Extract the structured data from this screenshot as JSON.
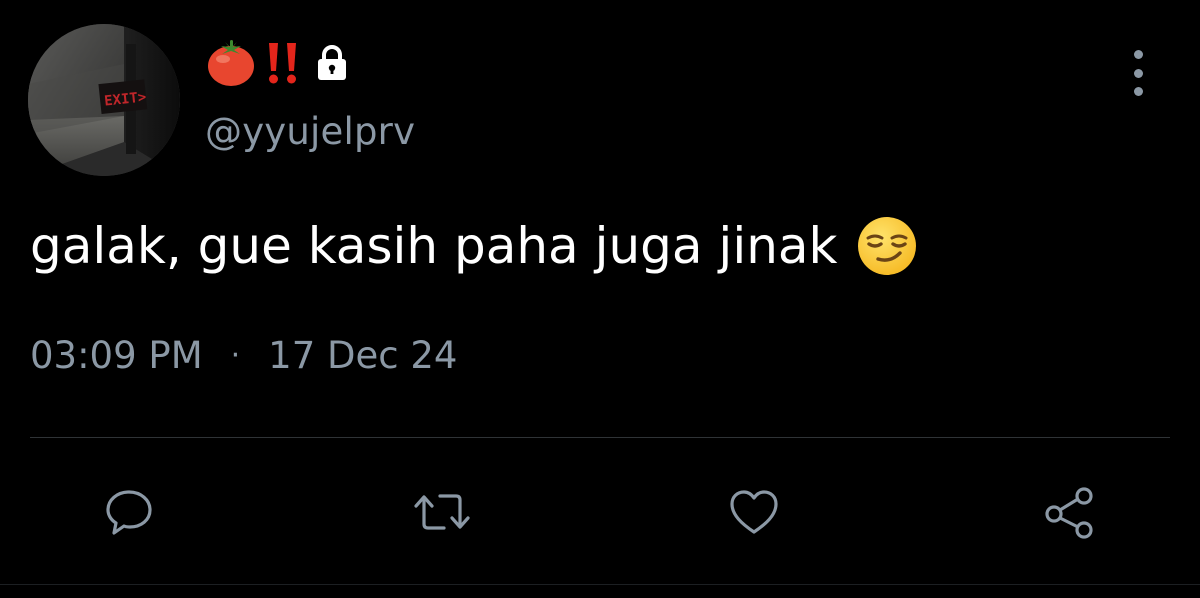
{
  "tweet": {
    "display_name_icons": [
      "tomato-emoji",
      "double-exclamation-emoji",
      "lock-icon"
    ],
    "handle": "@yyujelprv",
    "text": "galak, gue kasih paha juga jinak",
    "text_emoji": "smirking-face-emoji",
    "time": "03:09 PM",
    "separator": "·",
    "date": "17 Dec 24",
    "avatar_sign_text": "EXIT>"
  },
  "actions": [
    {
      "name": "reply",
      "icon": "comment-icon"
    },
    {
      "name": "retweet",
      "icon": "retweet-icon"
    },
    {
      "name": "like",
      "icon": "heart-icon"
    },
    {
      "name": "share",
      "icon": "share-icon"
    }
  ],
  "colors": {
    "background": "#000000",
    "text_primary": "#ffffff",
    "text_secondary": "#8b98a5",
    "divider": "#2f3336",
    "exit_sign": "#c0262a"
  }
}
